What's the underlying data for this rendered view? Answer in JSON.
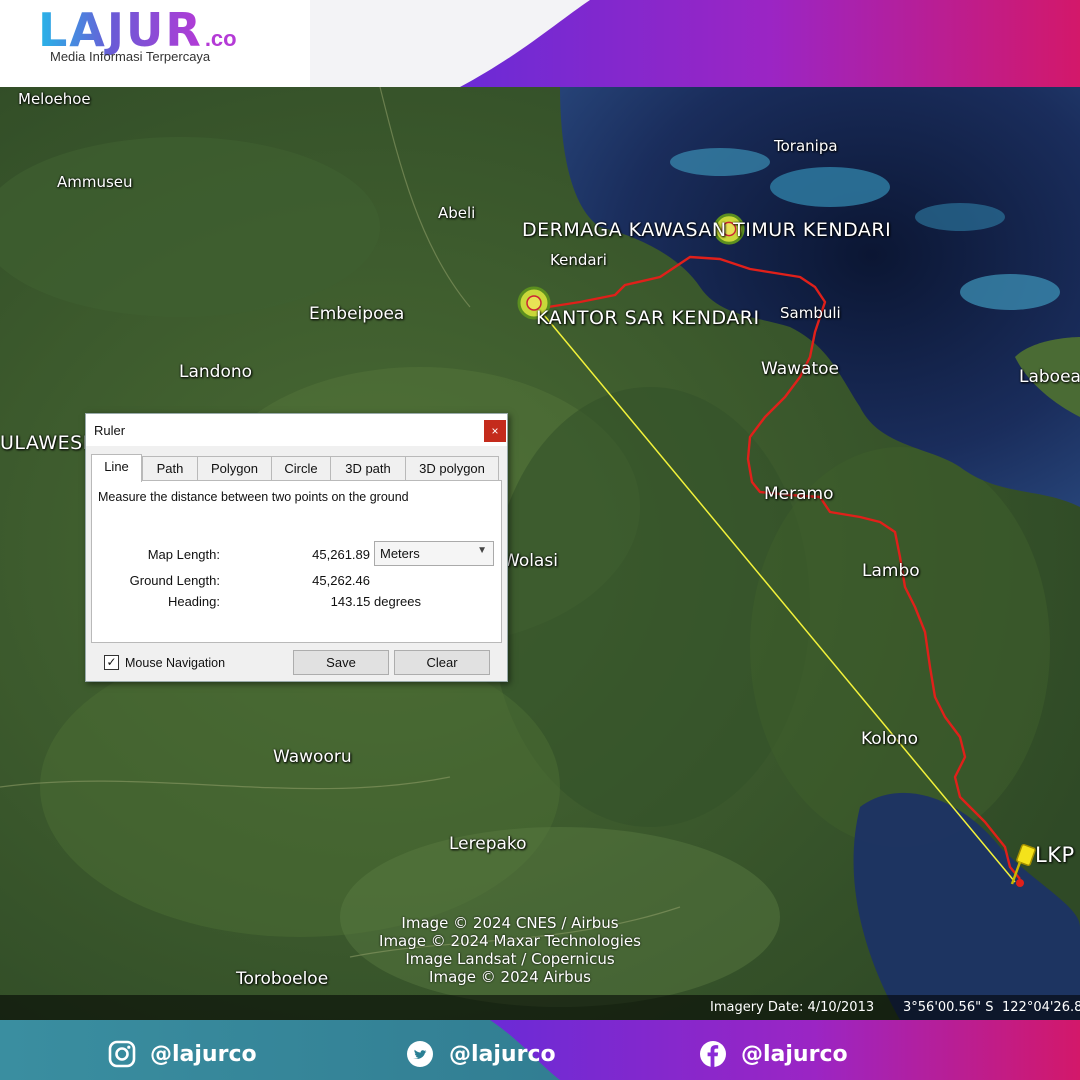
{
  "brand": {
    "logo_text": "LAJUR",
    "logo_suffix": ".co",
    "tagline": "Media Informasi Terpercaya",
    "colors": {
      "cyan": "#27b5e8",
      "purple": "#8a2ad6",
      "magenta": "#d11a6e"
    }
  },
  "map": {
    "places": {
      "meloehoe": "Meloehoe",
      "ammuseu": "Ammuseu",
      "abeli": "Abeli",
      "toranipa": "Toranipa",
      "dermaga": "DERMAGA KAWASAN TIMUR KENDARI",
      "kendari": "Kendari",
      "embeipoea": "Embeipoea",
      "kantor_sar": "KANTOR SAR KENDARI",
      "sambuli": "Sambuli",
      "landono": "Landono",
      "wawatoe": "Wawatoe",
      "laboea": "Laboea",
      "sulawesi": "ULAWESI",
      "meramo": "Meramo",
      "wolasi": "Wolasi",
      "lambo": "Lambo",
      "kolono": "Kolono",
      "wawooru": "Wawooru",
      "lerepako": "Lerepako",
      "lkp": "LKP",
      "toroboeloe": "Toroboeloe"
    },
    "credits": [
      "Image © 2024 CNES / Airbus",
      "Image © 2024 Maxar Technologies",
      "Image Landsat / Copernicus",
      "Image © 2024 Airbus"
    ],
    "status": {
      "imagery_date": "Imagery Date: 4/10/2013",
      "latitude": "3°56'00.56\" S",
      "longitude": "122°04'26.8"
    },
    "route_color": "#e0201a",
    "ruler_line_color": "#f2f23a"
  },
  "ruler_dialog": {
    "title": "Ruler",
    "close_glyph": "×",
    "tabs": [
      "Line",
      "Path",
      "Polygon",
      "Circle",
      "3D path",
      "3D polygon"
    ],
    "active_tab": "Line",
    "description": "Measure the distance between two points on the ground",
    "map_length_label": "Map Length:",
    "map_length_value": "45,261.89",
    "unit": "Meters",
    "ground_length_label": "Ground Length:",
    "ground_length_value": "45,262.46",
    "heading_label": "Heading:",
    "heading_value": "143.15 degrees",
    "mouse_navigation_label": "Mouse Navigation",
    "mouse_navigation_checked": true,
    "check_glyph": "✓",
    "save_label": "Save",
    "clear_label": "Clear"
  },
  "footer": {
    "instagram": "@lajurco",
    "twitter": "@lajurco",
    "facebook": "@lajurco"
  }
}
